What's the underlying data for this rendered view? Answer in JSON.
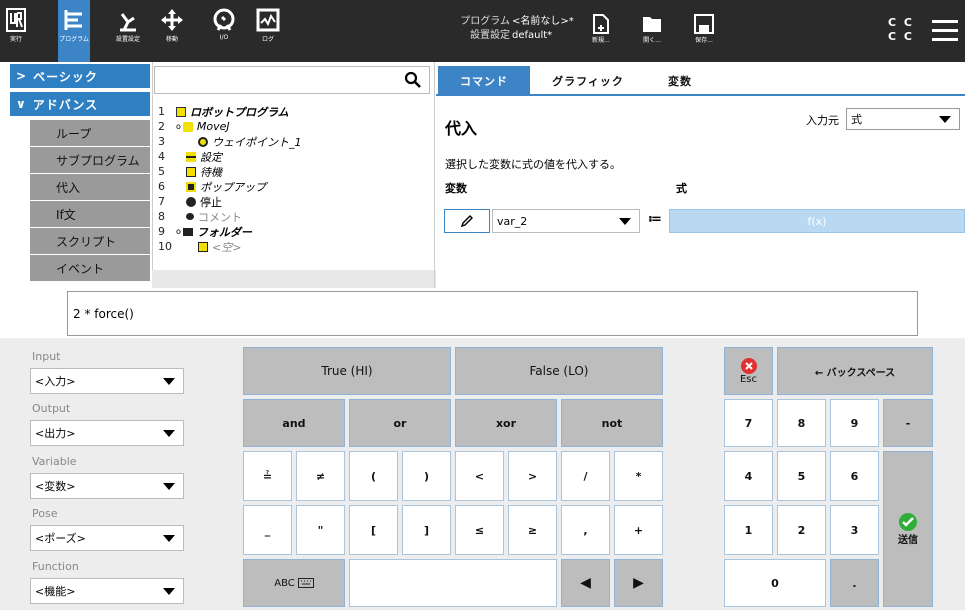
{
  "topbar": {
    "tabs": [
      {
        "label": "実行"
      },
      {
        "label": "プログラム"
      },
      {
        "label": "設置設定"
      },
      {
        "label": "移動"
      },
      {
        "label": "I/O"
      },
      {
        "label": "ログ"
      }
    ],
    "program_label": "プログラム",
    "program_name": "<名前なし>*",
    "setup_label": "設置設定",
    "setup_name": "default*",
    "file_buttons": [
      {
        "label": "新規..."
      },
      {
        "label": "開く..."
      },
      {
        "label": "保存..."
      }
    ],
    "status_top": "C C",
    "status_bottom": "C C"
  },
  "nav": {
    "basic": "ベーシック",
    "advanced": "アドバンス",
    "items": [
      {
        "label": "ループ"
      },
      {
        "label": "サブプログラム"
      },
      {
        "label": "代入"
      },
      {
        "label": "If文"
      },
      {
        "label": "スクリプト"
      },
      {
        "label": "イベント"
      }
    ]
  },
  "tree": [
    {
      "num": "1",
      "text": "ロボットプログラム"
    },
    {
      "num": "2",
      "text": "MoveJ"
    },
    {
      "num": "3",
      "text": "ウェイポイント_1"
    },
    {
      "num": "4",
      "text": "設定"
    },
    {
      "num": "5",
      "text": "待機"
    },
    {
      "num": "6",
      "text": "ポップアップ"
    },
    {
      "num": "7",
      "text": "停止"
    },
    {
      "num": "8",
      "text": "コメント"
    },
    {
      "num": "9",
      "text": "フォルダー"
    },
    {
      "num": "10",
      "text": "<空>"
    }
  ],
  "tabs": [
    {
      "label": "コマンド"
    },
    {
      "label": "グラフィック"
    },
    {
      "label": "変数"
    }
  ],
  "panel": {
    "title": "代入",
    "source_label": "入力元",
    "source_value": "式",
    "description": "選択した変数に式の値を代入する。",
    "var_header": "変数",
    "expr_header": "式",
    "var_value": "var_2",
    "assign_op": "≔",
    "expr_placeholder": "f(x)"
  },
  "expression": "2 * force()",
  "fields": [
    {
      "label": "Input",
      "value": "<入力>"
    },
    {
      "label": "Output",
      "value": "<出力>"
    },
    {
      "label": "Variable",
      "value": "<変数>"
    },
    {
      "label": "Pose",
      "value": "<ポーズ>"
    },
    {
      "label": "Function",
      "value": "<機能>"
    }
  ],
  "keys": {
    "true": "True (HI)",
    "false": "False (LO)",
    "ops": [
      "and",
      "or",
      "xor",
      "not"
    ],
    "row3": [
      "≟",
      "≠",
      "(",
      ")",
      "<",
      ">",
      "/",
      "*"
    ],
    "row4": [
      "_",
      "\"",
      "[",
      "]",
      "≤",
      "≥",
      ",",
      "+"
    ],
    "abc": "ABC",
    "esc": "Esc",
    "backspace": "← バックスペース",
    "numpad": [
      "7",
      "8",
      "9",
      "-",
      "4",
      "5",
      "6",
      "1",
      "2",
      "3",
      "0",
      "."
    ],
    "send": "送信"
  }
}
